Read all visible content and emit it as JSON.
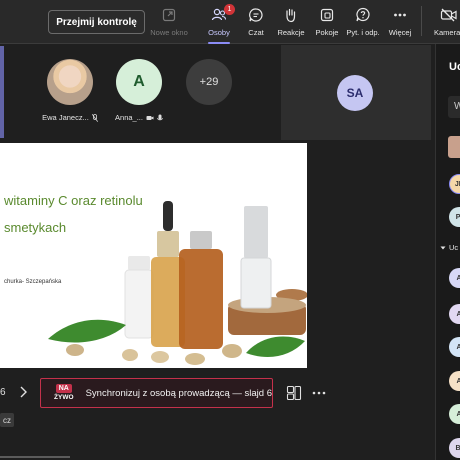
{
  "toolbar": {
    "take_control": "Przejmij kontrolę",
    "new_window": "Nowe okno",
    "people": "Osoby",
    "people_badge": "1",
    "chat": "Czat",
    "reactions": "Reakcje",
    "rooms": "Pokoje",
    "qa": "Pyt. i odp.",
    "more": "Więcej",
    "camera": "Kamera"
  },
  "participants": [
    {
      "name": "Ewa Janecz...",
      "avatar": "photo"
    },
    {
      "name": "Anna_...",
      "initials": "A"
    },
    {
      "overflow": "+29"
    }
  ],
  "presenter_tile": {
    "initials": "SA"
  },
  "slide": {
    "title_line1": "witaminy C  oraz retinolu",
    "title_line2": "smetykach",
    "author": "churka- Szczepańska"
  },
  "controls": {
    "page": "6",
    "live_na": "NA",
    "live_zywo": "ŻYWO",
    "sync_text": "Synchronizuj z osobą prowadzącą — slajd 6",
    "small_tag": "cz"
  },
  "side_panel": {
    "title": "Uc",
    "search_placeholder": "W",
    "section_label": "Uc",
    "avatars": [
      "JL",
      "Pl",
      "A",
      "A",
      "A",
      "A",
      "A",
      "Bl"
    ]
  },
  "colors": {
    "accent": "#6264a7",
    "live_red": "#c4314b",
    "slide_title": "#5a8a2e"
  }
}
